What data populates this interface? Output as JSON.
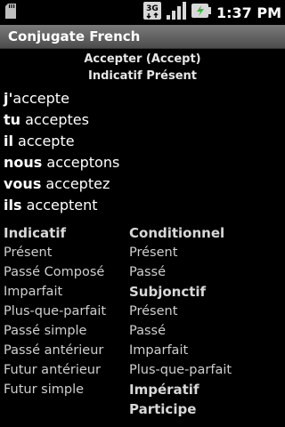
{
  "status": {
    "time": "1:37 PM",
    "network_label": "3G",
    "icons": [
      "sd-card-icon",
      "3g-data-icon",
      "signal-icon",
      "battery-icon"
    ]
  },
  "app": {
    "title": "Conjugate French"
  },
  "verb": {
    "title": "Accepter (Accept)",
    "tense": "Indicatif Présent"
  },
  "conjugations": [
    {
      "pronoun": "j'",
      "form": "accepte"
    },
    {
      "pronoun": "tu",
      "form": " acceptes"
    },
    {
      "pronoun": "il",
      "form": " accepte"
    },
    {
      "pronoun": "nous",
      "form": " acceptons"
    },
    {
      "pronoun": "vous",
      "form": " acceptez"
    },
    {
      "pronoun": "ils",
      "form": " acceptent"
    }
  ],
  "menu": {
    "indicatif": {
      "heading": "Indicatif",
      "items": [
        "Présent",
        "Passé Composé",
        "Imparfait",
        "Plus-que-parfait",
        "Passé simple",
        "Passé antérieur",
        "Futur antérieur",
        "Futur simple"
      ]
    },
    "conditionnel": {
      "heading": "Conditionnel",
      "items": [
        "Présent",
        "Passé"
      ]
    },
    "subjonctif": {
      "heading": "Subjonctif",
      "items": [
        "Présent",
        "Passé",
        "Imparfait",
        "Plus-que-parfait"
      ]
    },
    "imperatif": {
      "heading": "Impératif"
    },
    "participe": {
      "heading": "Participe"
    }
  }
}
